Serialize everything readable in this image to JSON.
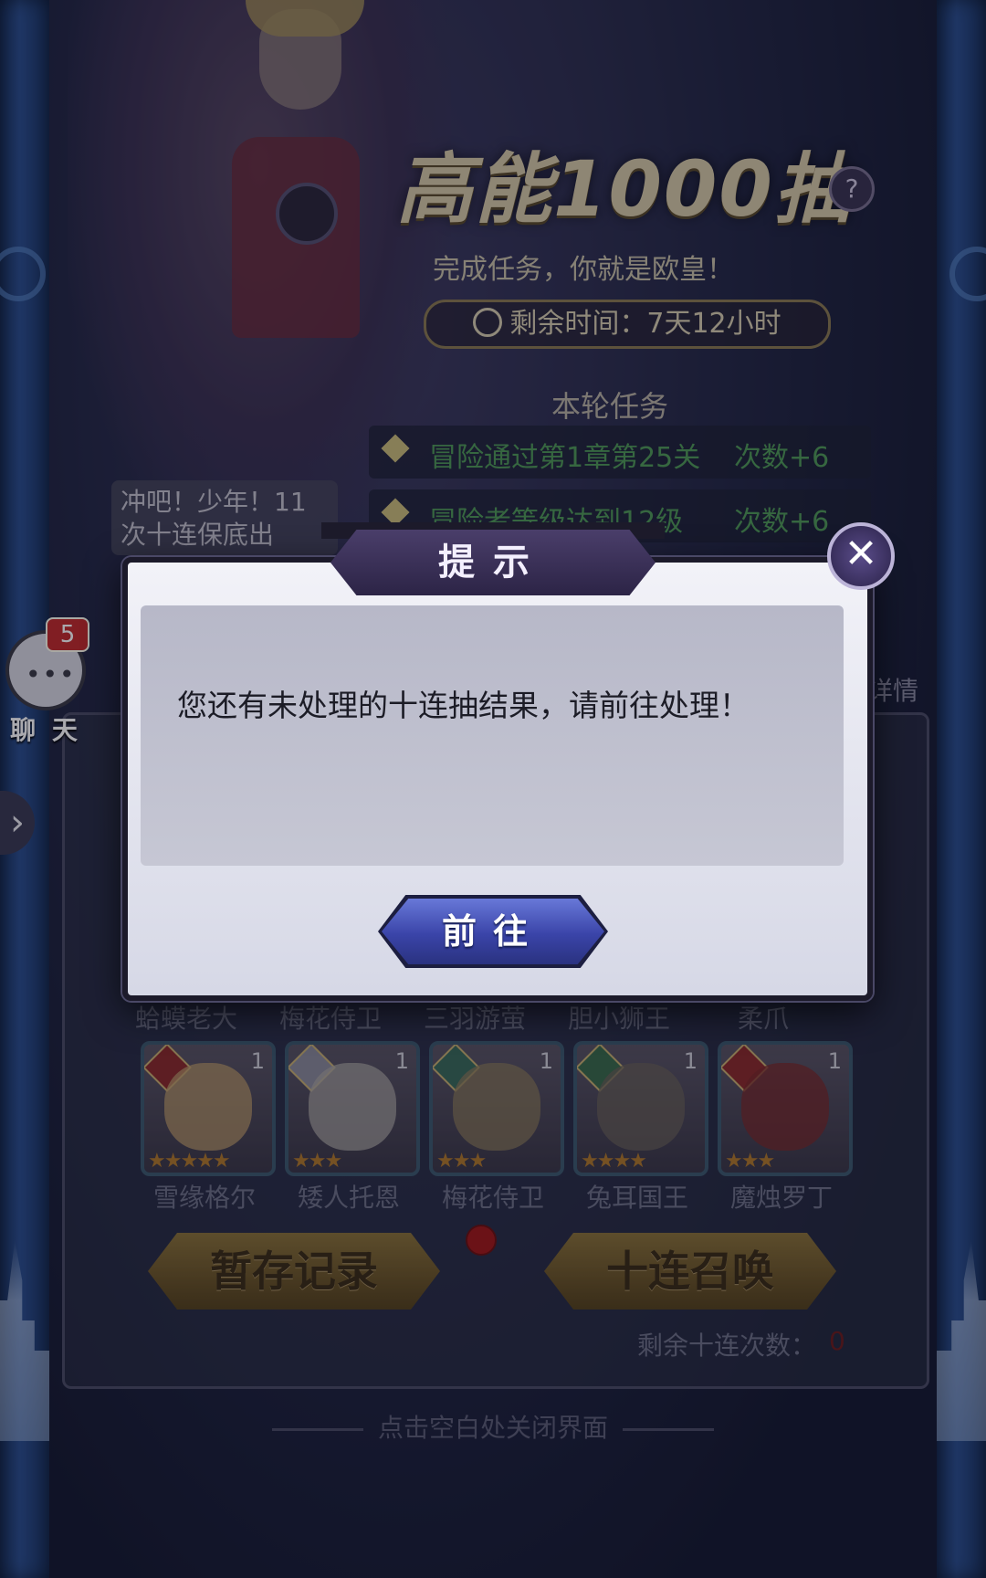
{
  "event": {
    "title": "高能1000抽",
    "help_icon": "?",
    "subtitle": "完成任务，你就是欧皇！",
    "timer_label": "剩余时间：7天12小时",
    "tasks_heading": "本轮任务",
    "tasks": [
      {
        "text": "冒险通过第1章第25关",
        "reward": "次数+6"
      },
      {
        "text": "冒险者等级达到12级",
        "reward": "次数+6"
      }
    ]
  },
  "speech_bubble": "冲吧！少年！11次十连保底出",
  "chat": {
    "label": "聊 天",
    "badge": "5"
  },
  "right_partial_label": "详情",
  "pool": {
    "top_names": [
      "蛤蟆老大",
      "梅花侍卫",
      "三羽游萤",
      "胆小狮王",
      "柔爪"
    ],
    "heroes": [
      {
        "name": "雪缘格尔",
        "level": "1",
        "stars": 5,
        "stars_text": "★★★★★"
      },
      {
        "name": "矮人托恩",
        "level": "1",
        "stars": 3,
        "stars_text": "★★★"
      },
      {
        "name": "梅花侍卫",
        "level": "1",
        "stars": 3,
        "stars_text": "★★★"
      },
      {
        "name": "兔耳国王",
        "level": "1",
        "stars": 4,
        "stars_text": "★★★★"
      },
      {
        "name": "魔烛罗丁",
        "level": "1",
        "stars": 3,
        "stars_text": "★★★"
      }
    ],
    "stash_button": "暂存记录",
    "summon_button": "十连召唤",
    "remaining_label": "剩余十连次数：",
    "remaining_value": "0",
    "close_hint": "点击空白处关闭界面"
  },
  "dialog": {
    "title": "提示",
    "message": "您还有未处理的十连抽结果，请前往处理！",
    "go_button": "前往",
    "close_icon": "✕"
  },
  "colors": {
    "task_green": "#4f9a56",
    "dialog_button": "#3a44a8",
    "gold_button": "#6a5426",
    "badge_red": "#c22a2a"
  }
}
